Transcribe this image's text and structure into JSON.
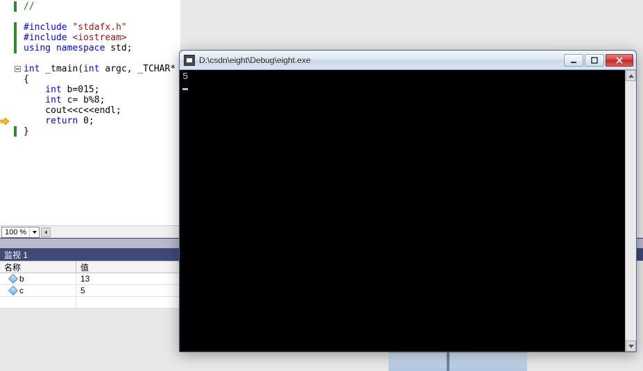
{
  "code": {
    "l1": "//",
    "l3a": "#include",
    "l3b": " \"stdafx.h\"",
    "l4a": "#include",
    "l4b": " <iostream>",
    "l5a": "using namespace",
    "l5b": " std;",
    "l7a": "int",
    "l7b": " _tmain(",
    "l7c": "int",
    "l7d": " argc, _TCHAR* a",
    "l8": "{",
    "l9a": "    int",
    "l9b": " b=015;",
    "l10a": "    int",
    "l10b": " c= b%8;",
    "l11": "    cout<<c<<endl;",
    "l12a": "    return",
    "l12b": " 0;",
    "l13": "}"
  },
  "zoom": {
    "value": "100 %"
  },
  "watch": {
    "title": "监视 1",
    "header": {
      "name": "名称",
      "value": "值"
    },
    "rows": [
      {
        "name": "b",
        "value": "13"
      },
      {
        "name": "c",
        "value": "5"
      }
    ]
  },
  "console": {
    "title": "D:\\csdn\\eight\\Debug\\eight.exe",
    "output": "5"
  }
}
